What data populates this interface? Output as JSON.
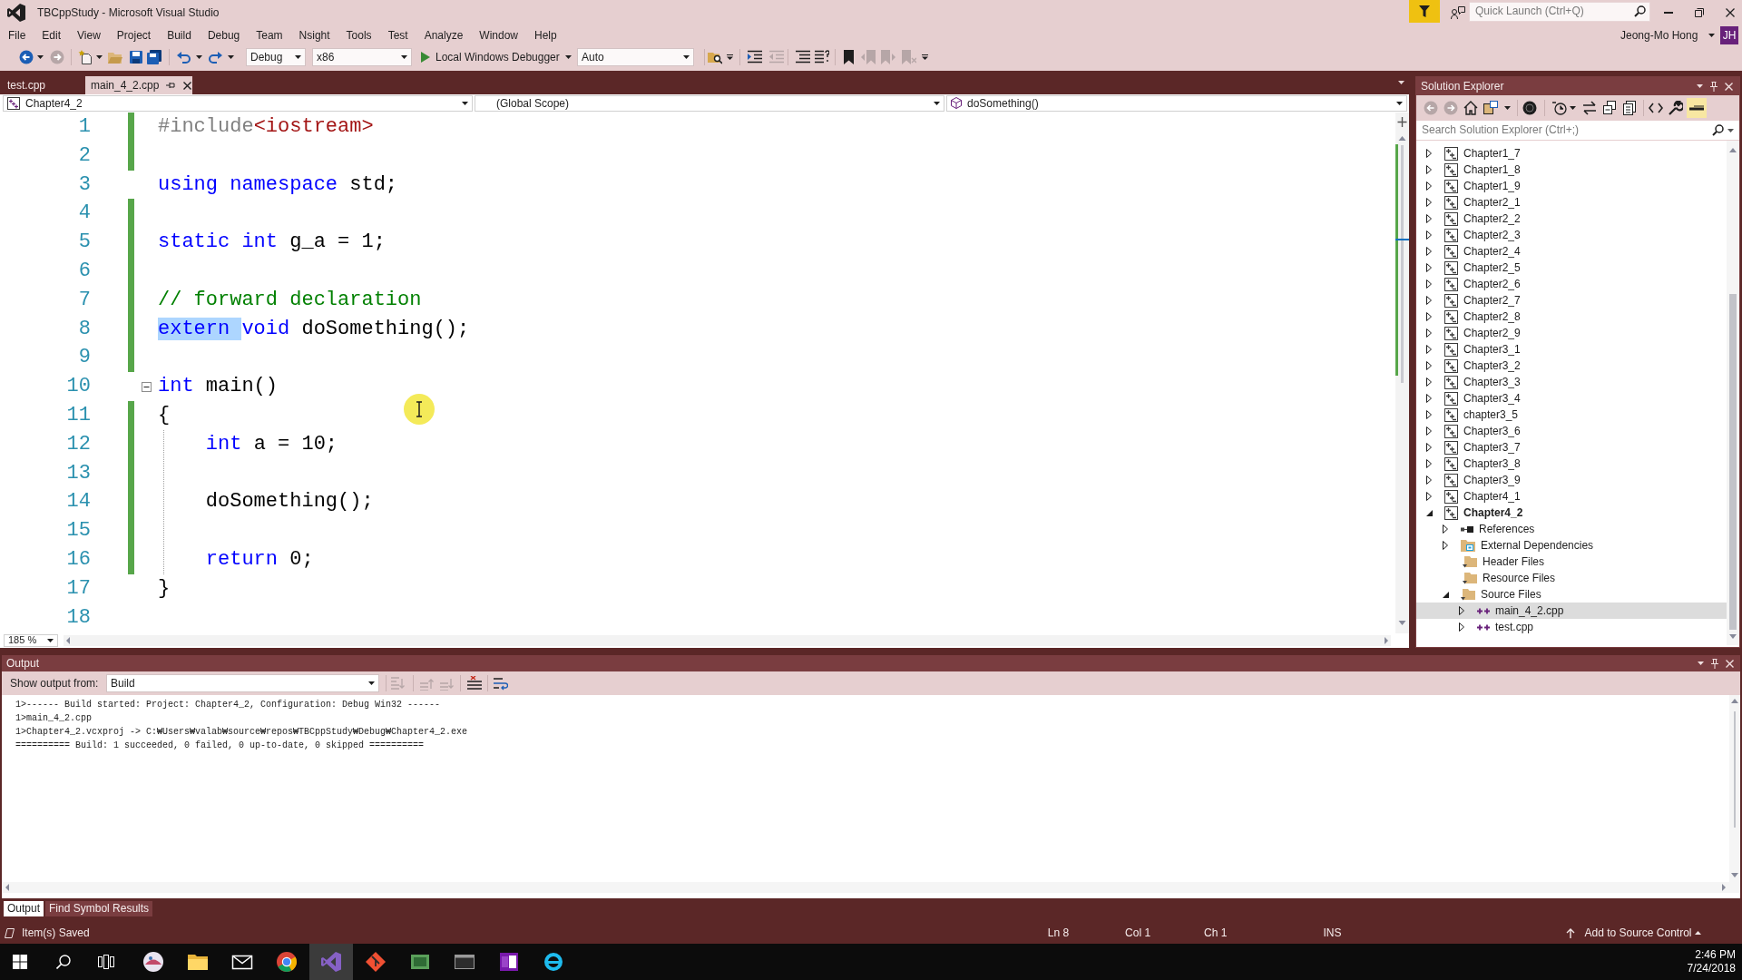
{
  "window": {
    "title": "TBCppStudy - Microsoft Visual Studio",
    "quick_launch": {
      "placeholder": "Quick Launch (Ctrl+Q)"
    }
  },
  "menu": [
    "File",
    "Edit",
    "View",
    "Project",
    "Build",
    "Debug",
    "Team",
    "Nsight",
    "Tools",
    "Test",
    "Analyze",
    "Window",
    "Help"
  ],
  "account": {
    "name": "Jeong-Mo Hong",
    "initials": "JH"
  },
  "toolbar": {
    "navigation": [
      {
        "disabled": false
      },
      {
        "disabled": true
      }
    ],
    "configuration": "Debug",
    "platform": "x86",
    "start": "Local Windows Debugger",
    "stack_frame": "Auto",
    "tools": [
      {
        "disabled": false
      },
      {
        "disabled": false
      },
      {
        "disabled": true
      },
      {
        "disabled": false
      },
      {
        "disabled": false
      },
      {
        "disabled": false
      },
      {
        "disabled": true
      },
      {
        "disabled": true
      },
      {
        "disabled": true
      }
    ]
  },
  "tabs": [
    {
      "label": "test.cpp",
      "selected": false
    },
    {
      "label": "main_4_2.cpp",
      "selected": true
    }
  ],
  "navigation_bar": {
    "project": "Chapter4_2",
    "scope": "(Global Scope)",
    "member": "doSomething()"
  },
  "editor": {
    "lines": [
      {
        "number": "1",
        "changed": true,
        "tokens": [
          {
            "text": "#include",
            "kind": "directive"
          },
          {
            "text": "<iostream>",
            "kind": "string"
          }
        ]
      },
      {
        "number": "2",
        "changed": true
      },
      {
        "number": "3",
        "changed": false,
        "tokens": [
          {
            "text": "using",
            "kind": "keyword"
          },
          {
            "text": " namespace",
            "kind": "keyword"
          },
          {
            "text": " std;",
            "kind": "plain"
          }
        ]
      },
      {
        "number": "4",
        "changed": true
      },
      {
        "number": "5",
        "changed": true,
        "tokens": [
          {
            "text": "static",
            "kind": "keyword"
          },
          {
            "text": " int",
            "kind": "keyword"
          },
          {
            "text": " g_a = 1;",
            "kind": "plain"
          }
        ]
      },
      {
        "number": "6",
        "changed": true
      },
      {
        "number": "7",
        "changed": true,
        "tokens": [
          {
            "text": "// forward declaration",
            "kind": "comment"
          }
        ]
      },
      {
        "number": "8",
        "changed": true,
        "tokens": [
          {
            "text": "extern ",
            "kind": "keyword",
            "selected": true
          },
          {
            "text": "void",
            "kind": "keyword"
          },
          {
            "text": " doSomething();",
            "kind": "plain"
          }
        ]
      },
      {
        "number": "9",
        "changed": true
      },
      {
        "number": "10",
        "changed": false,
        "folded": false,
        "tokens": [
          {
            "text": "int",
            "kind": "keyword"
          },
          {
            "text": " main()",
            "kind": "plain"
          }
        ]
      },
      {
        "number": "11",
        "changed": true,
        "tokens": [
          {
            "text": "{",
            "kind": "plain"
          }
        ]
      },
      {
        "number": "12",
        "changed": true,
        "tokens": [
          {
            "text": "    int",
            "kind": "keyword"
          },
          {
            "text": " a = 10;",
            "kind": "plain"
          }
        ]
      },
      {
        "number": "13",
        "changed": true
      },
      {
        "number": "14",
        "changed": true,
        "tokens": [
          {
            "text": "    doSomething();",
            "kind": "plain"
          }
        ]
      },
      {
        "number": "15",
        "changed": true
      },
      {
        "number": "16",
        "changed": true,
        "tokens": [
          {
            "text": "    return",
            "kind": "keyword"
          },
          {
            "text": " 0;",
            "kind": "plain"
          }
        ]
      },
      {
        "number": "17",
        "changed": false,
        "tokens": [
          {
            "text": "}",
            "kind": "plain"
          }
        ]
      },
      {
        "number": "18",
        "changed": false
      }
    ],
    "zoom": "185 %"
  },
  "solution_explorer": {
    "title": "Solution Explorer",
    "tools": [
      {
        "disabled": true
      },
      {
        "disabled": true
      },
      {
        "disabled": false
      },
      {
        "disabled": false
      },
      {
        "disabled": false
      },
      {
        "disabled": false
      },
      {
        "disabled": false
      },
      {
        "disabled": false
      },
      {
        "disabled": false
      },
      {
        "disabled": false
      },
      {
        "disabled": false
      },
      {
        "disabled": false,
        "on": true
      }
    ],
    "search": {
      "placeholder": "Search Solution Explorer (Ctrl+;)"
    },
    "items": [
      {
        "label": "Chapter1_7",
        "kind": "project",
        "expanded": false,
        "selected": false,
        "startup": false
      },
      {
        "label": "Chapter1_8",
        "kind": "project",
        "expanded": false,
        "selected": false,
        "startup": false
      },
      {
        "label": "Chapter1_9",
        "kind": "project",
        "expanded": false,
        "selected": false,
        "startup": false
      },
      {
        "label": "Chapter2_1",
        "kind": "project",
        "expanded": false,
        "selected": false,
        "startup": false
      },
      {
        "label": "Chapter2_2",
        "kind": "project",
        "expanded": false,
        "selected": false,
        "startup": false
      },
      {
        "label": "Chapter2_3",
        "kind": "project",
        "expanded": false,
        "selected": false,
        "startup": false
      },
      {
        "label": "Chapter2_4",
        "kind": "project",
        "expanded": false,
        "selected": false,
        "startup": false
      },
      {
        "label": "Chapter2_5",
        "kind": "project",
        "expanded": false,
        "selected": false,
        "startup": false
      },
      {
        "label": "Chapter2_6",
        "kind": "project",
        "expanded": false,
        "selected": false,
        "startup": false
      },
      {
        "label": "Chapter2_7",
        "kind": "project",
        "expanded": false,
        "selected": false,
        "startup": false
      },
      {
        "label": "Chapter2_8",
        "kind": "project",
        "expanded": false,
        "selected": false,
        "startup": false
      },
      {
        "label": "Chapter2_9",
        "kind": "project",
        "expanded": false,
        "selected": false,
        "startup": false
      },
      {
        "label": "Chapter3_1",
        "kind": "project",
        "expanded": false,
        "selected": false,
        "startup": false
      },
      {
        "label": "Chapter3_2",
        "kind": "project",
        "expanded": false,
        "selected": false,
        "startup": false
      },
      {
        "label": "Chapter3_3",
        "kind": "project",
        "expanded": false,
        "selected": false,
        "startup": false
      },
      {
        "label": "Chapter3_4",
        "kind": "project",
        "expanded": false,
        "selected": false,
        "startup": false
      },
      {
        "label": "chapter3_5",
        "kind": "project",
        "expanded": false,
        "selected": false,
        "startup": false
      },
      {
        "label": "Chapter3_6",
        "kind": "project",
        "expanded": false,
        "selected": false,
        "startup": false
      },
      {
        "label": "Chapter3_7",
        "kind": "project",
        "expanded": false,
        "selected": false,
        "startup": false
      },
      {
        "label": "Chapter3_8",
        "kind": "project",
        "expanded": false,
        "selected": false,
        "startup": false
      },
      {
        "label": "Chapter3_9",
        "kind": "project",
        "expanded": false,
        "selected": false,
        "startup": false
      },
      {
        "label": "Chapter4_1",
        "kind": "project",
        "expanded": false,
        "selected": false,
        "startup": false
      },
      {
        "label": "Chapter4_2",
        "kind": "project",
        "expanded": true,
        "selected": false,
        "startup": true,
        "children": [
          {
            "label": "References",
            "kind": "references",
            "expanded": false,
            "selected": false
          },
          {
            "label": "External Dependencies",
            "kind": "dependencies",
            "expanded": false,
            "selected": false
          },
          {
            "label": "Header Files",
            "kind": "filter",
            "selected": false
          },
          {
            "label": "Resource Files",
            "kind": "filter",
            "selected": false
          },
          {
            "label": "Source Files",
            "kind": "filter",
            "expanded": true,
            "selected": false,
            "children": [
              {
                "label": "main_4_2.cpp",
                "kind": "file",
                "expanded": false,
                "selected": true
              },
              {
                "label": "test.cpp",
                "kind": "file",
                "expanded": false,
                "selected": false
              }
            ]
          }
        ]
      }
    ]
  },
  "output": {
    "title": "Output",
    "source_label": "Show output from:",
    "source": "Build",
    "tools": [
      {
        "disabled": true
      },
      {
        "disabled": true
      },
      {
        "disabled": true
      },
      {
        "disabled": false
      },
      {
        "disabled": false
      }
    ],
    "lines": [
      "1>------ Build started: Project: Chapter4_2, Configuration: Debug Win32 ------",
      "1>main_4_2.cpp",
      "1>Chapter4_2.vcxproj -> C:₩Users₩valab₩source₩repos₩TBCppStudy₩Debug₩Chapter4_2.exe",
      "========== Build: 1 succeeded, 0 failed, 0 up-to-date, 0 skipped =========="
    ],
    "tabs": [
      {
        "label": "Output",
        "selected": true
      },
      {
        "label": "Find Symbol Results",
        "selected": false
      }
    ]
  },
  "status_bar": {
    "message": "Item(s) Saved",
    "line": "Ln 8",
    "column": "Col 1",
    "character": "Ch 1",
    "mode": "INS",
    "source_control": "Add to Source Control"
  },
  "taskbar": {
    "apps": [
      {
        "selected": false
      },
      {
        "selected": false
      },
      {
        "selected": false
      },
      {
        "selected": false
      },
      {
        "selected": true
      },
      {
        "selected": false
      },
      {
        "selected": false
      },
      {
        "selected": false
      },
      {
        "selected": false
      },
      {
        "selected": false
      }
    ],
    "time": "2:46 PM",
    "date": "7/24/2018"
  }
}
